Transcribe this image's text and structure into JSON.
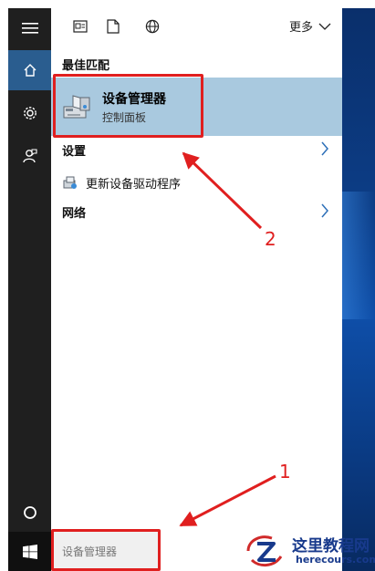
{
  "rail": {
    "items": [
      {
        "name": "hamburger-menu-icon"
      },
      {
        "name": "home-icon",
        "active": true
      },
      {
        "name": "settings-gear-icon"
      },
      {
        "name": "feedback-icon"
      }
    ],
    "bottom": {
      "name": "cortana-circle-icon"
    }
  },
  "top_bar": {
    "icons": [
      "documents-filter-icon",
      "file-filter-icon",
      "web-filter-icon"
    ],
    "more_label": "更多"
  },
  "best_match": {
    "section_label": "最佳匹配",
    "title": "设备管理器",
    "subtitle": "控制面板"
  },
  "settings_row": {
    "label": "设置"
  },
  "sub_item": {
    "label": "更新设备驱动程序"
  },
  "network_row": {
    "label": "网络"
  },
  "search": {
    "value": "设备管理器"
  },
  "annotations": {
    "one": "1",
    "two": "2"
  },
  "watermark": {
    "title": "这里教程网",
    "url": "herecours.com"
  },
  "colors": {
    "highlight": "#a9c9df",
    "rail": "#1f1f1f",
    "rail_active": "#2a5d8f",
    "annotation": "#e01f1f"
  }
}
